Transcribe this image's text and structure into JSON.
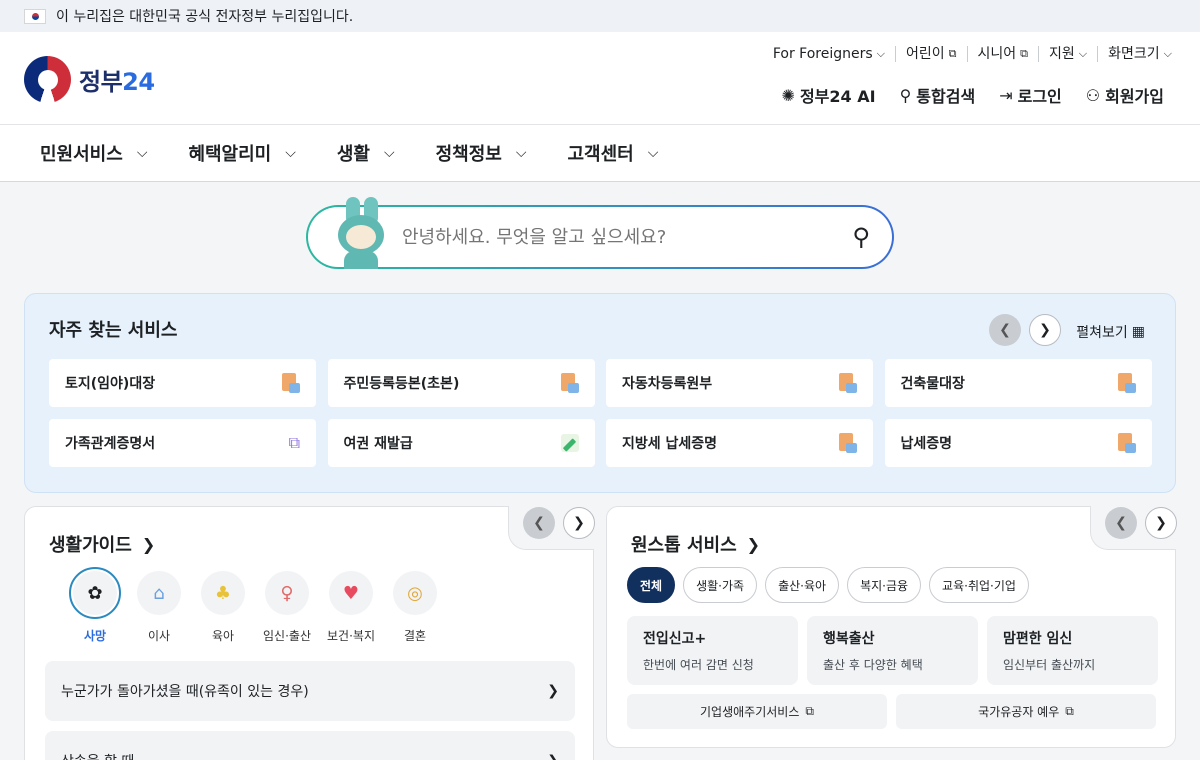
{
  "topbar": {
    "notice": "이 누리집은 대한민국 공식 전자정부 누리집입니다."
  },
  "logo": {
    "text_main": "정부",
    "text_num": "24"
  },
  "util": [
    {
      "label": "For Foreigners",
      "icon": "chevron-down-icon"
    },
    {
      "label": "어린이",
      "icon": "external-link-icon"
    },
    {
      "label": "시니어",
      "icon": "external-link-icon"
    },
    {
      "label": "지원",
      "icon": "chevron-down-icon"
    },
    {
      "label": "화면크기",
      "icon": "chevron-down-icon"
    }
  ],
  "actions": {
    "ai": "정부24 AI",
    "search": "통합검색",
    "login": "로그인",
    "signup": "회원가입"
  },
  "nav": [
    "민원서비스",
    "혜택알리미",
    "생활",
    "정책정보",
    "고객센터"
  ],
  "search": {
    "placeholder": "안녕하세요. 무엇을 알고 싶으세요?"
  },
  "frequent": {
    "title": "자주 찾는 서비스",
    "expand": "펼쳐보기",
    "items": [
      {
        "label": "토지(임야)대장",
        "icon": "document-icon"
      },
      {
        "label": "주민등록등본(초본)",
        "icon": "document-icon"
      },
      {
        "label": "자동차등록원부",
        "icon": "document-icon"
      },
      {
        "label": "건축물대장",
        "icon": "document-icon"
      },
      {
        "label": "가족관계증명서",
        "icon": "external-link-icon"
      },
      {
        "label": "여권 재발급",
        "icon": "pen-icon"
      },
      {
        "label": "지방세 납세증명",
        "icon": "document-icon"
      },
      {
        "label": "납세증명",
        "icon": "document-icon"
      }
    ]
  },
  "life_guide": {
    "title": "생활가이드",
    "categories": [
      {
        "label": "사망",
        "selected": true
      },
      {
        "label": "이사",
        "selected": false
      },
      {
        "label": "육아",
        "selected": false
      },
      {
        "label": "임신·출산",
        "selected": false
      },
      {
        "label": "보건·복지",
        "selected": false
      },
      {
        "label": "결혼",
        "selected": false
      }
    ],
    "rows": [
      "누군가가 돌아가셨을 때(유족이 있는 경우)",
      "상속을 할 때"
    ]
  },
  "onestop": {
    "title": "원스톱 서비스",
    "tabs": [
      "전체",
      "생활·가족",
      "출산·육아",
      "복지·금융",
      "교육·취업·기업"
    ],
    "items": [
      {
        "title": "전입신고+",
        "sub": "한번에 여러 감면 신청"
      },
      {
        "title": "행복출산",
        "sub": "출산 후 다양한 혜택"
      },
      {
        "title": "맘편한 임신",
        "sub": "임신부터 출산까지"
      }
    ],
    "links": [
      "기업생애주기서비스",
      "국가유공자 예우"
    ]
  }
}
